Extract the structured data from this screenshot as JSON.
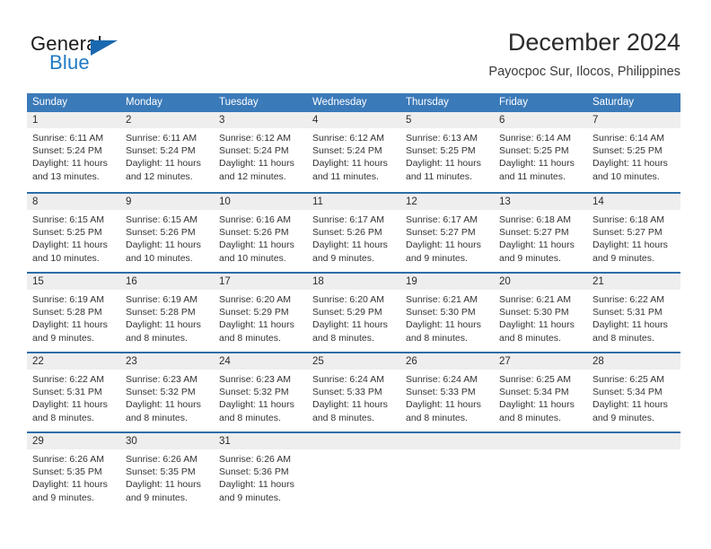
{
  "brand": {
    "name_top": "General",
    "name_bottom": "Blue",
    "accent_color": "#1f7ac4",
    "flag_color": "#1a68b0"
  },
  "header": {
    "title": "December 2024",
    "subtitle": "Payocpoc Sur, Ilocos, Philippines"
  },
  "calendar": {
    "header_bg": "#3b7ab9",
    "row_divider": "#2e6da9",
    "day_band_bg": "#eeeeee",
    "weekdays": [
      "Sunday",
      "Monday",
      "Tuesday",
      "Wednesday",
      "Thursday",
      "Friday",
      "Saturday"
    ],
    "weeks": [
      [
        {
          "day": "1",
          "lines": [
            "Sunrise: 6:11 AM",
            "Sunset: 5:24 PM",
            "Daylight: 11 hours",
            "and 13 minutes."
          ]
        },
        {
          "day": "2",
          "lines": [
            "Sunrise: 6:11 AM",
            "Sunset: 5:24 PM",
            "Daylight: 11 hours",
            "and 12 minutes."
          ]
        },
        {
          "day": "3",
          "lines": [
            "Sunrise: 6:12 AM",
            "Sunset: 5:24 PM",
            "Daylight: 11 hours",
            "and 12 minutes."
          ]
        },
        {
          "day": "4",
          "lines": [
            "Sunrise: 6:12 AM",
            "Sunset: 5:24 PM",
            "Daylight: 11 hours",
            "and 11 minutes."
          ]
        },
        {
          "day": "5",
          "lines": [
            "Sunrise: 6:13 AM",
            "Sunset: 5:25 PM",
            "Daylight: 11 hours",
            "and 11 minutes."
          ]
        },
        {
          "day": "6",
          "lines": [
            "Sunrise: 6:14 AM",
            "Sunset: 5:25 PM",
            "Daylight: 11 hours",
            "and 11 minutes."
          ]
        },
        {
          "day": "7",
          "lines": [
            "Sunrise: 6:14 AM",
            "Sunset: 5:25 PM",
            "Daylight: 11 hours",
            "and 10 minutes."
          ]
        }
      ],
      [
        {
          "day": "8",
          "lines": [
            "Sunrise: 6:15 AM",
            "Sunset: 5:25 PM",
            "Daylight: 11 hours",
            "and 10 minutes."
          ]
        },
        {
          "day": "9",
          "lines": [
            "Sunrise: 6:15 AM",
            "Sunset: 5:26 PM",
            "Daylight: 11 hours",
            "and 10 minutes."
          ]
        },
        {
          "day": "10",
          "lines": [
            "Sunrise: 6:16 AM",
            "Sunset: 5:26 PM",
            "Daylight: 11 hours",
            "and 10 minutes."
          ]
        },
        {
          "day": "11",
          "lines": [
            "Sunrise: 6:17 AM",
            "Sunset: 5:26 PM",
            "Daylight: 11 hours",
            "and 9 minutes."
          ]
        },
        {
          "day": "12",
          "lines": [
            "Sunrise: 6:17 AM",
            "Sunset: 5:27 PM",
            "Daylight: 11 hours",
            "and 9 minutes."
          ]
        },
        {
          "day": "13",
          "lines": [
            "Sunrise: 6:18 AM",
            "Sunset: 5:27 PM",
            "Daylight: 11 hours",
            "and 9 minutes."
          ]
        },
        {
          "day": "14",
          "lines": [
            "Sunrise: 6:18 AM",
            "Sunset: 5:27 PM",
            "Daylight: 11 hours",
            "and 9 minutes."
          ]
        }
      ],
      [
        {
          "day": "15",
          "lines": [
            "Sunrise: 6:19 AM",
            "Sunset: 5:28 PM",
            "Daylight: 11 hours",
            "and 9 minutes."
          ]
        },
        {
          "day": "16",
          "lines": [
            "Sunrise: 6:19 AM",
            "Sunset: 5:28 PM",
            "Daylight: 11 hours",
            "and 8 minutes."
          ]
        },
        {
          "day": "17",
          "lines": [
            "Sunrise: 6:20 AM",
            "Sunset: 5:29 PM",
            "Daylight: 11 hours",
            "and 8 minutes."
          ]
        },
        {
          "day": "18",
          "lines": [
            "Sunrise: 6:20 AM",
            "Sunset: 5:29 PM",
            "Daylight: 11 hours",
            "and 8 minutes."
          ]
        },
        {
          "day": "19",
          "lines": [
            "Sunrise: 6:21 AM",
            "Sunset: 5:30 PM",
            "Daylight: 11 hours",
            "and 8 minutes."
          ]
        },
        {
          "day": "20",
          "lines": [
            "Sunrise: 6:21 AM",
            "Sunset: 5:30 PM",
            "Daylight: 11 hours",
            "and 8 minutes."
          ]
        },
        {
          "day": "21",
          "lines": [
            "Sunrise: 6:22 AM",
            "Sunset: 5:31 PM",
            "Daylight: 11 hours",
            "and 8 minutes."
          ]
        }
      ],
      [
        {
          "day": "22",
          "lines": [
            "Sunrise: 6:22 AM",
            "Sunset: 5:31 PM",
            "Daylight: 11 hours",
            "and 8 minutes."
          ]
        },
        {
          "day": "23",
          "lines": [
            "Sunrise: 6:23 AM",
            "Sunset: 5:32 PM",
            "Daylight: 11 hours",
            "and 8 minutes."
          ]
        },
        {
          "day": "24",
          "lines": [
            "Sunrise: 6:23 AM",
            "Sunset: 5:32 PM",
            "Daylight: 11 hours",
            "and 8 minutes."
          ]
        },
        {
          "day": "25",
          "lines": [
            "Sunrise: 6:24 AM",
            "Sunset: 5:33 PM",
            "Daylight: 11 hours",
            "and 8 minutes."
          ]
        },
        {
          "day": "26",
          "lines": [
            "Sunrise: 6:24 AM",
            "Sunset: 5:33 PM",
            "Daylight: 11 hours",
            "and 8 minutes."
          ]
        },
        {
          "day": "27",
          "lines": [
            "Sunrise: 6:25 AM",
            "Sunset: 5:34 PM",
            "Daylight: 11 hours",
            "and 8 minutes."
          ]
        },
        {
          "day": "28",
          "lines": [
            "Sunrise: 6:25 AM",
            "Sunset: 5:34 PM",
            "Daylight: 11 hours",
            "and 9 minutes."
          ]
        }
      ],
      [
        {
          "day": "29",
          "lines": [
            "Sunrise: 6:26 AM",
            "Sunset: 5:35 PM",
            "Daylight: 11 hours",
            "and 9 minutes."
          ]
        },
        {
          "day": "30",
          "lines": [
            "Sunrise: 6:26 AM",
            "Sunset: 5:35 PM",
            "Daylight: 11 hours",
            "and 9 minutes."
          ]
        },
        {
          "day": "31",
          "lines": [
            "Sunrise: 6:26 AM",
            "Sunset: 5:36 PM",
            "Daylight: 11 hours",
            "and 9 minutes."
          ]
        },
        {
          "day": "",
          "lines": []
        },
        {
          "day": "",
          "lines": []
        },
        {
          "day": "",
          "lines": []
        },
        {
          "day": "",
          "lines": []
        }
      ]
    ]
  }
}
